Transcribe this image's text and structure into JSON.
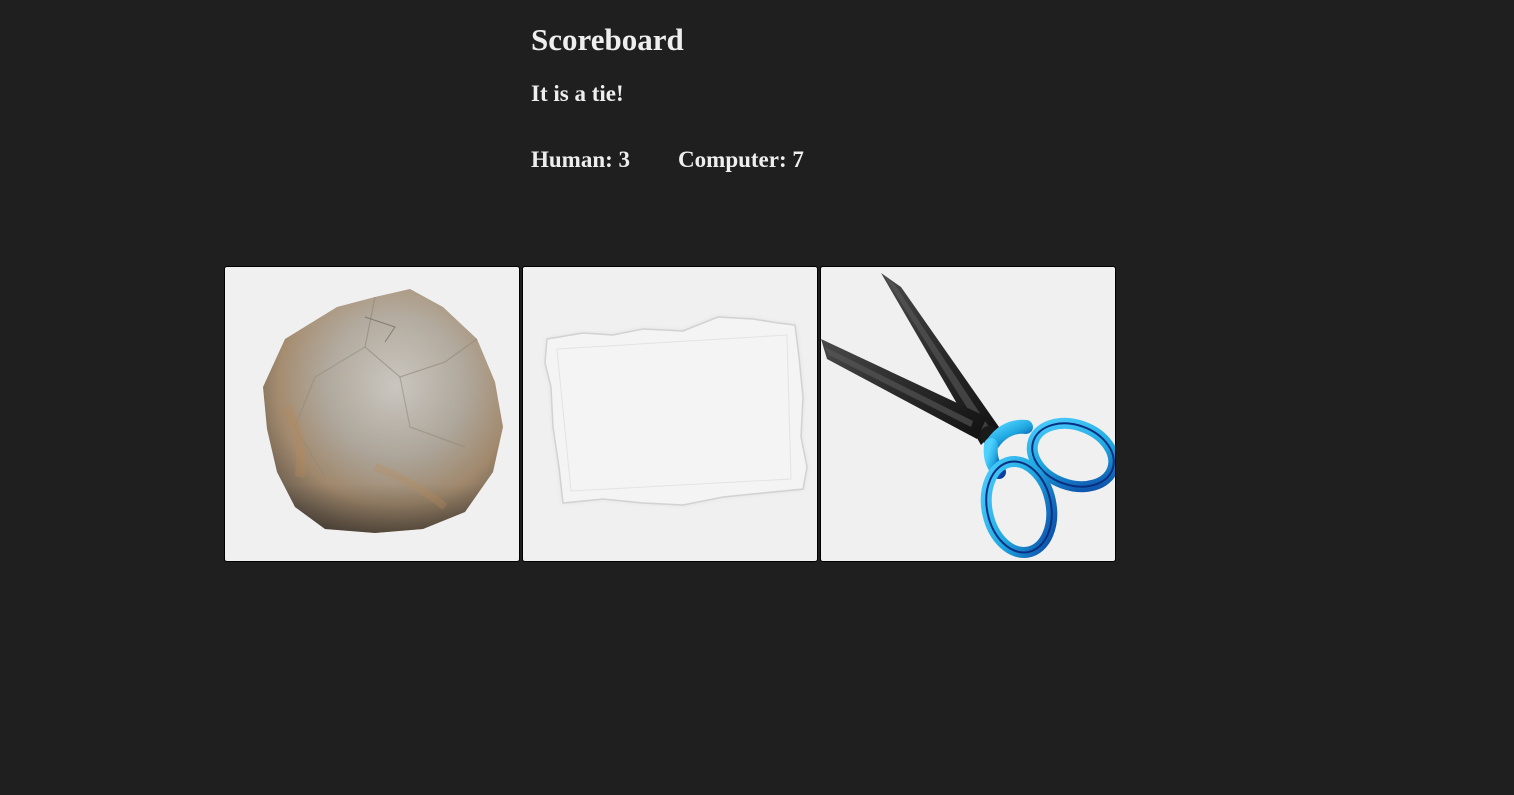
{
  "scoreboard": {
    "title": "Scoreboard",
    "result": "It is a tie!",
    "human_label": "Human: 3",
    "computer_label": "Computer: 7"
  },
  "choices": [
    {
      "name": "rock",
      "icon": "rock-icon"
    },
    {
      "name": "paper",
      "icon": "paper-icon"
    },
    {
      "name": "scissors",
      "icon": "scissors-icon"
    }
  ],
  "colors": {
    "background": "#1f1f1f",
    "text": "#eeeeee",
    "card": "#f0f0f0",
    "scissors_handle": "#1fa8e0",
    "scissors_blade": "#2a2a2a"
  }
}
